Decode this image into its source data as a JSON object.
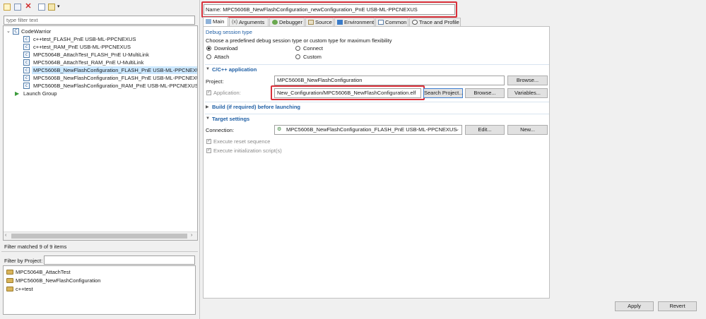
{
  "left": {
    "filter_placeholder": "type filter text",
    "tree": {
      "root_label": "CodeWarrior",
      "items": [
        "c++test_FLASH_PnE USB-ML-PPCNEXUS",
        "c++test_RAM_PnE USB-ML-PPCNEXUS",
        "MPC5064B_AttachTest_FLASH_PnE U-MultiLink",
        "MPC5064B_AttachTest_RAM_PnE U-MultiLink",
        "MPC5606B_NewFlashConfiguration_FLASH_PnE USB-ML-PPCNEXUS",
        "MPC5606B_NewFlashConfiguration_FLASH_PnE USB-ML-PPCNEXUS (",
        "MPC5606B_NewFlashConfiguration_RAM_PnE USB-ML-PPCNEXUS"
      ],
      "launch_group": "Launch Group"
    },
    "filter_status": "Filter matched 9 of 9 items",
    "filter_by_project_label": "Filter by Project:",
    "projects": [
      "MPC5064B_AttachTest",
      "MPC5606B_NewFlashConfiguration",
      "c++test"
    ]
  },
  "right": {
    "name_label": "Name:",
    "name_value": "MPC5606B_NewFlashConfiguration_newConfiguration_PnE USB-ML-PPCNEXUS",
    "tabs": [
      "Main",
      "Arguments",
      "Debugger",
      "Source",
      "Environment",
      "Common",
      "Trace and Profile"
    ],
    "debug_session": {
      "title": "Debug session type",
      "description": "Choose a predefined debug session type or custom type for maximum flexibility",
      "options": [
        "Download",
        "Connect",
        "Attach",
        "Custom"
      ],
      "selected": "Download"
    },
    "cpp_app": {
      "title": "C/C++ application",
      "project_label": "Project:",
      "project_value": "MPC5606B_NewFlashConfiguration",
      "browse_label": "Browse...",
      "application_label": "Application:",
      "application_value": "New_Configuration/MPC5606B_NewFlashConfiguration.elf",
      "search_project_label": "Search Project...",
      "browse2_label": "Browse...",
      "variables_label": "Variables..."
    },
    "build_section_title": "Build (if required) before launching",
    "target": {
      "title": "Target settings",
      "connection_label": "Connection:",
      "connection_value": "MPC5606B_NewFlashConfiguration_FLASH_PnE USB-ML-PPCNEXUS",
      "edit_label": "Edit...",
      "new_label": "New...",
      "reset_label": "Execute reset sequence",
      "init_label": "Execute initialization script(s)"
    },
    "apply_label": "Apply",
    "revert_label": "Revert"
  },
  "colors": {
    "highlight_red": "#d9303a",
    "section_blue": "#1f5fa5",
    "selection": "#cce8ff"
  }
}
